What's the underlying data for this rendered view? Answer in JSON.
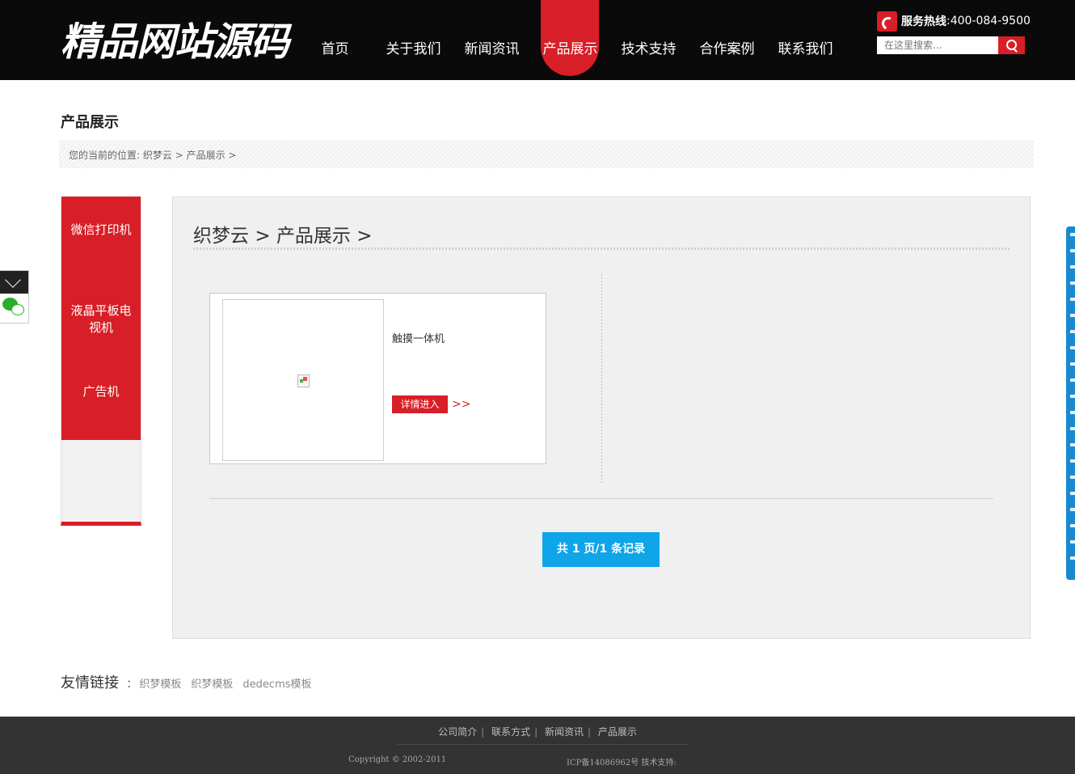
{
  "header": {
    "logo_text": "精品网站源码",
    "nav": [
      {
        "label": "首页",
        "active": false
      },
      {
        "label": "关于我们",
        "active": false
      },
      {
        "label": "新闻资讯",
        "active": false
      },
      {
        "label": "产品展示",
        "active": true
      },
      {
        "label": "技术支持",
        "active": false
      },
      {
        "label": "合作案例",
        "active": false
      },
      {
        "label": "联系我们",
        "active": false
      }
    ],
    "hotline_label": "服务热线",
    "hotline_number": ":400-084-9500",
    "search_placeholder": "在这里搜索..."
  },
  "page_title": "产品展示",
  "breadcrumb": {
    "prefix": "您的当前的位置:",
    "items": [
      "织梦云",
      "产品展示"
    ],
    "separator": ">"
  },
  "sidebar": {
    "items": [
      "微信打印机",
      "液晶平板电视机",
      "广告机"
    ]
  },
  "main": {
    "title_parts": [
      "织梦云",
      ">",
      "产品展示",
      ">"
    ],
    "product": {
      "name": "触摸一体机",
      "detail_button": "详情进入",
      "arrow": ">>"
    },
    "pager": "共 1 页/1 条记录"
  },
  "friend_links": {
    "label": "友情链接",
    "separator": ":",
    "links": [
      "织梦模板",
      "织梦模板",
      "dedecms模板"
    ]
  },
  "footer": {
    "nav": [
      "公司简介",
      "联系方式",
      "新闻资讯",
      "产品展示"
    ],
    "copyright": "Copyright © 2002-2011",
    "icp": "ICP备14086962号 技术支持:"
  },
  "colors": {
    "accent": "#d81e26",
    "header_bg": "#0a0a0a",
    "pager_bg": "#0ea5e9",
    "footer_bg": "#333333"
  }
}
